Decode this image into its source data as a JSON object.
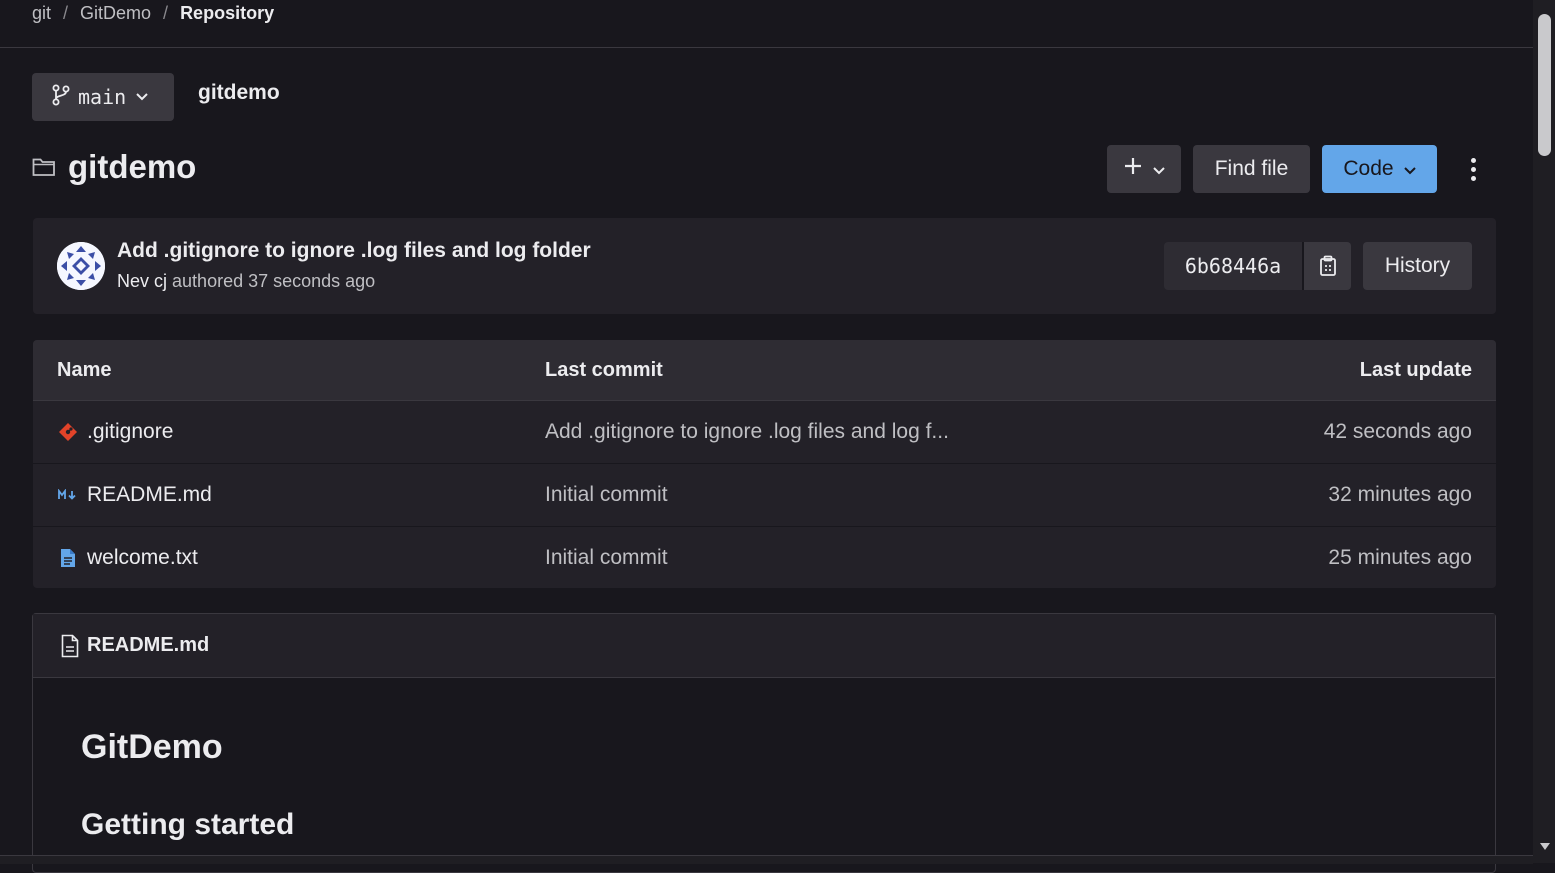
{
  "breadcrumb": {
    "items": [
      "git",
      "GitDemo"
    ],
    "current": "Repository"
  },
  "branch": {
    "name": "main"
  },
  "repo_path": "gitdemo",
  "title": "gitdemo",
  "actions": {
    "find_file": "Find file",
    "code": "Code",
    "code_color": "#63a6e9"
  },
  "last_commit": {
    "message": "Add .gitignore to ignore .log files and log folder",
    "author": "Nev cj",
    "authored_text": "authored 37 seconds ago",
    "sha": "6b68446a",
    "history_label": "History"
  },
  "table": {
    "headers": {
      "name": "Name",
      "last_commit": "Last commit",
      "last_update": "Last update"
    },
    "rows": [
      {
        "icon": "git-icon",
        "name": ".gitignore",
        "commit": "Add .gitignore to ignore .log files and log f...",
        "updated": "42 seconds ago"
      },
      {
        "icon": "markdown-icon",
        "name": "README.md",
        "commit": "Initial commit",
        "updated": "32 minutes ago"
      },
      {
        "icon": "text-file-icon",
        "name": "welcome.txt",
        "commit": "Initial commit",
        "updated": "25 minutes ago"
      }
    ]
  },
  "readme": {
    "filename": "README.md",
    "h1": "GitDemo",
    "h2": "Getting started"
  }
}
